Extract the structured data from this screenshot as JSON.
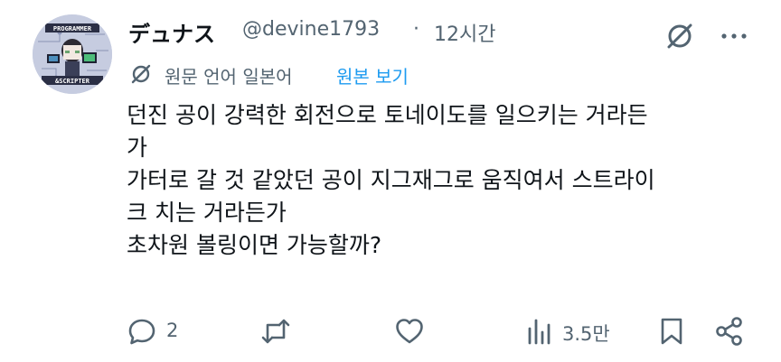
{
  "post": {
    "display_name": "デュナス",
    "handle": "@devine1793",
    "separator": "·",
    "time": "12시간",
    "avatar_icon": "avatar-icon",
    "avatar_text_top": "PROGRAMMER",
    "avatar_text_bottom": "&SCRIPTER",
    "translate": {
      "notice": "원문 언어 일본어",
      "link": "원본 보기",
      "icon": "grok-icon"
    },
    "body_lines": [
      "던진 공이 강력한 회전으로 토네이도를 일으키는 거라든",
      "가",
      "가터로 갈 것 같았던 공이 지그재그로 움직여서 스트라이",
      "크 치는 거라든가",
      "초차원 볼링이면 가능할까?"
    ]
  },
  "actions": {
    "reply_count": "2",
    "repost_count": "",
    "like_count": "",
    "views_count": "3.5만",
    "icons": [
      "reply-icon",
      "repost-icon",
      "like-icon",
      "views-icon",
      "bookmark-icon",
      "share-icon"
    ]
  },
  "colors": {
    "text": "#0f1419",
    "muted": "#536471",
    "link": "#1d9bf0"
  }
}
